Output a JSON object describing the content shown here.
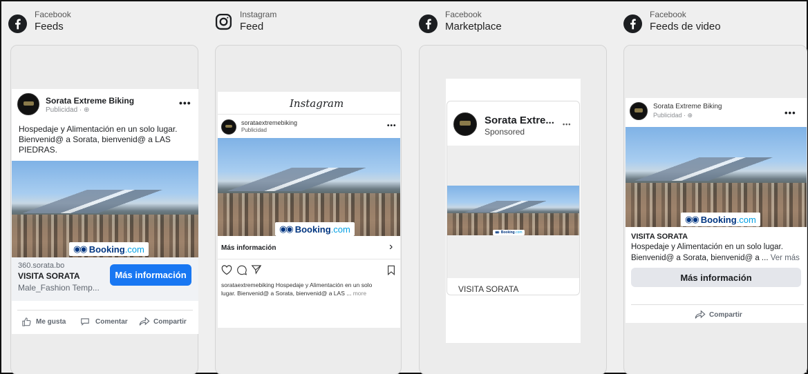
{
  "columns": [
    {
      "platform": "Facebook",
      "placement": "Feeds",
      "icon": "facebook-icon"
    },
    {
      "platform": "Instagram",
      "placement": "Feed",
      "icon": "instagram-icon"
    },
    {
      "platform": "Facebook",
      "placement": "Marketplace",
      "icon": "facebook-icon"
    },
    {
      "platform": "Facebook",
      "placement": "Feeds de video",
      "icon": "facebook-icon"
    }
  ],
  "colors": {
    "facebook_blue": "#1877f2",
    "booking_navy": "#003580",
    "booking_cyan": "#009fe3"
  },
  "fb_feed": {
    "page_name": "Sorata Extreme Biking",
    "sponsored": "Publicidad · ",
    "body_line1": "Hospedaje y Alimentación en un solo lugar.",
    "body_line2": "Bienvenid@ a Sorata, bienvenid@ a LAS",
    "body_line3": "PIEDRAS.",
    "link_domain": "360.sorata.bo",
    "headline": "VISITA SORATA",
    "description": "Male_Fashion Temp...",
    "cta": "Más información",
    "like": "Me gusta",
    "comment": "Comentar",
    "share": "Compartir"
  },
  "booking": {
    "brand": "Booking",
    "suffix": ".com"
  },
  "ig_feed": {
    "logo": "Instagram",
    "handle": "sorataextremebiking",
    "sponsored": "Publicidad",
    "cta": "Más información",
    "caption_line1": "sorataextremebiking Hospedaje y Alimentación en un solo",
    "caption_line2": "lugar. Bienvenid@ a Sorata, bienvenid@ a LAS ...",
    "more": "more"
  },
  "marketplace": {
    "page_name": "Sorata Extre...",
    "sponsored": "Sponsored",
    "headline": "VISITA SORATA"
  },
  "fb_video": {
    "page_name": "Sorata Extreme Biking",
    "sponsored": "Publicidad · ",
    "headline": "VISITA SORATA",
    "body_line1": "Hospedaje y Alimentación en un solo lugar.",
    "body_line2": "Bienvenid@ a Sorata, bienvenid@ a  ...",
    "see_more": "Ver más",
    "cta": "Más información",
    "share": "Compartir"
  }
}
